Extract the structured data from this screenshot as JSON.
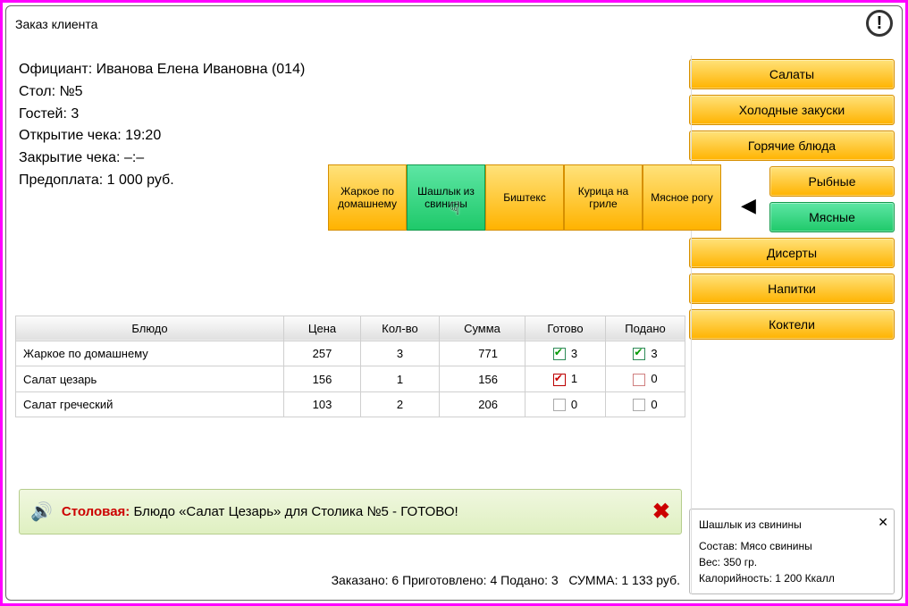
{
  "window": {
    "title": "Заказ клиента"
  },
  "header": {
    "waiter_label": "Официант:",
    "waiter": "Иванова Елена Ивановна (014)",
    "table_label": "Стол:",
    "table": "№5",
    "guests_label": "Гостей:",
    "guests": "3",
    "open_label": "Открытие чека:",
    "open_time": "19:20",
    "close_label": "Закрытие чека:",
    "close_time": "–:–",
    "prepay_label": "Предоплата:",
    "prepay": "1 000 руб."
  },
  "categories": [
    {
      "label": "Салаты",
      "sub": false,
      "active": false
    },
    {
      "label": "Холодные закуски",
      "sub": false,
      "active": false
    },
    {
      "label": "Горячие блюда",
      "sub": false,
      "active": false
    },
    {
      "label": "Рыбные",
      "sub": true,
      "active": false
    },
    {
      "label": "Мясные",
      "sub": true,
      "active": true
    },
    {
      "label": "Дисерты",
      "sub": false,
      "active": false
    },
    {
      "label": "Напитки",
      "sub": false,
      "active": false
    },
    {
      "label": "Коктели",
      "sub": false,
      "active": false
    }
  ],
  "dishes": [
    {
      "label": "Жаркое по домашнему",
      "active": false
    },
    {
      "label": "Шашлык из свинины",
      "active": true
    },
    {
      "label": "Биштекс",
      "active": false
    },
    {
      "label": "Курица на гриле",
      "active": false
    },
    {
      "label": "Мясное рогу",
      "active": false
    }
  ],
  "table_headers": {
    "dish": "Блюдо",
    "price": "Цена",
    "qty": "Кол-во",
    "sum": "Сумма",
    "ready": "Готово",
    "served": "Подано"
  },
  "order": [
    {
      "name": "Жаркое по домашнему",
      "price": 257,
      "qty": 3,
      "sum": 771,
      "ready_n": 3,
      "ready_state": "green",
      "served_n": 3,
      "served_state": "green"
    },
    {
      "name": "Салат цезарь",
      "price": 156,
      "qty": 1,
      "sum": 156,
      "ready_n": 1,
      "ready_state": "red",
      "served_n": 0,
      "served_state": "empty-red"
    },
    {
      "name": "Салат греческий",
      "price": 103,
      "qty": 2,
      "sum": 206,
      "ready_n": 0,
      "ready_state": "empty-gray",
      "served_n": 0,
      "served_state": "empty-gray"
    }
  ],
  "notice": {
    "source": "Столовая:",
    "text": "Блюдо «Салат Цезарь» для Столика №5 - ГОТОВО!"
  },
  "totals": {
    "ordered_l": "Заказано:",
    "ordered": 6,
    "cooked_l": "Приготовлено:",
    "cooked": 4,
    "served_l": "Подано:",
    "served": 3,
    "sum_l": "СУММА:",
    "sum": "1 133 руб."
  },
  "details": {
    "title": "Шашлык из свинины",
    "comp_l": "Состав:",
    "comp": "Мясо свинины",
    "weight_l": "Вес:",
    "weight": "350 гр.",
    "cal_l": "Калорийность:",
    "cal": "1 200 Ккалл"
  }
}
